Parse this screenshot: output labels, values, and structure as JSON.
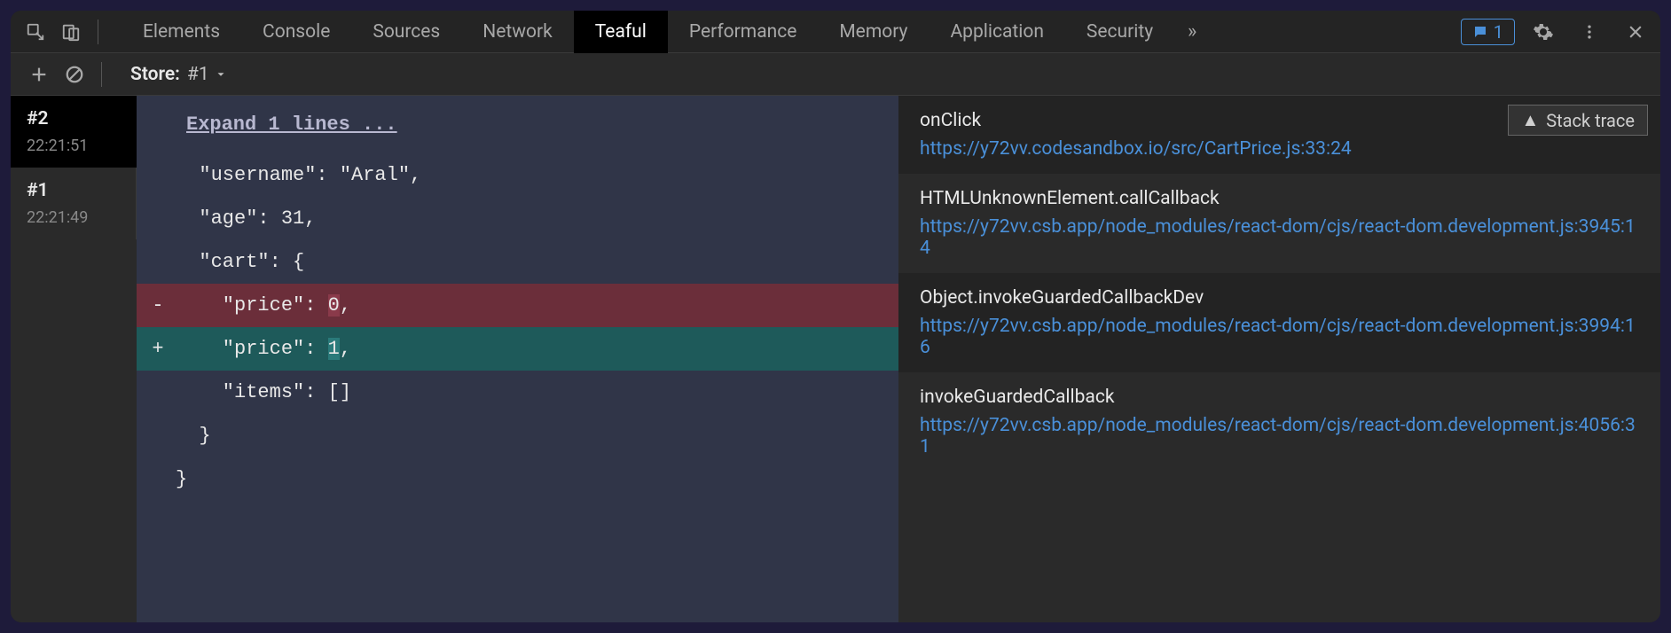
{
  "topbar": {
    "tabs": [
      "Elements",
      "Console",
      "Sources",
      "Network",
      "Teaful",
      "Performance",
      "Memory",
      "Application",
      "Security"
    ],
    "active_tab": "Teaful",
    "badge_count": "1"
  },
  "subbar": {
    "store_label": "Store:",
    "store_value": "#1"
  },
  "sidebar": {
    "items": [
      {
        "id": "#2",
        "time": "22:21:51"
      },
      {
        "id": "#1",
        "time": "22:21:49"
      }
    ],
    "active_index": 0
  },
  "diff": {
    "expand_label": "Expand 1 lines ...",
    "lines": [
      {
        "type": "ctx",
        "text": "  \"username\": \"Aral\","
      },
      {
        "type": "ctx",
        "text": "  \"age\": 31,"
      },
      {
        "type": "ctx",
        "text": "  \"cart\": {"
      },
      {
        "type": "removed",
        "prefix": "    \"price\": ",
        "hl": "0",
        "suffix": ","
      },
      {
        "type": "added",
        "prefix": "    \"price\": ",
        "hl": "1",
        "suffix": ","
      },
      {
        "type": "ctx",
        "text": "    \"items\": []"
      },
      {
        "type": "ctx",
        "text": "  }"
      },
      {
        "type": "ctx",
        "text": "}"
      }
    ]
  },
  "stack": {
    "toggle_label": "Stack trace",
    "frames": [
      {
        "name": "onClick",
        "link": "https://y72vv.codesandbox.io/src/CartPrice.js:33:24"
      },
      {
        "name": "HTMLUnknownElement.callCallback",
        "link": "https://y72vv.csb.app/node_modules/react-dom/cjs/react-dom.development.js:3945:14"
      },
      {
        "name": "Object.invokeGuardedCallbackDev",
        "link": "https://y72vv.csb.app/node_modules/react-dom/cjs/react-dom.development.js:3994:16"
      },
      {
        "name": "invokeGuardedCallback",
        "link": "https://y72vv.csb.app/node_modules/react-dom/cjs/react-dom.development.js:4056:31"
      }
    ]
  }
}
